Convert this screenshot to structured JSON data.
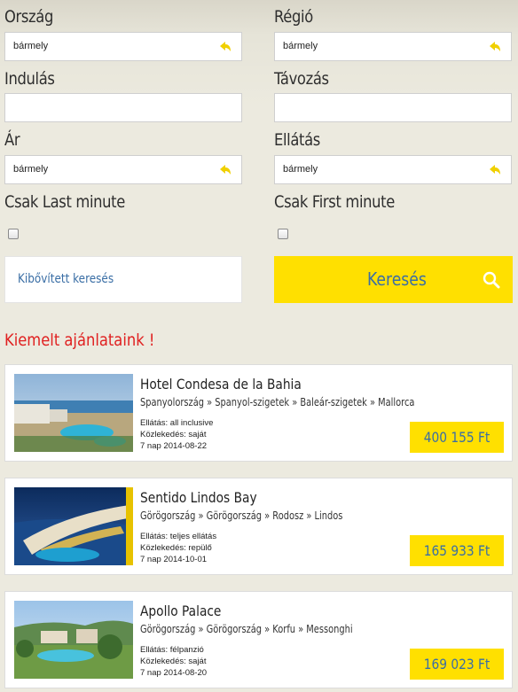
{
  "form": {
    "country": {
      "label": "Ország",
      "value": "bármely"
    },
    "region": {
      "label": "Régió",
      "value": "bármely"
    },
    "departure": {
      "label": "Indulás",
      "value": ""
    },
    "return": {
      "label": "Távozás",
      "value": ""
    },
    "price": {
      "label": "Ár",
      "value": "bármely"
    },
    "board": {
      "label": "Ellátás",
      "value": "bármely"
    },
    "last_minute": {
      "label": "Csak Last minute",
      "checked": false
    },
    "first_minute": {
      "label": "Csak First minute",
      "checked": false
    },
    "advanced_label": "Kibővített keresés",
    "search_label": "Keresés"
  },
  "colors": {
    "accent_yellow": "#ffe000",
    "link_blue": "#3a6ea5",
    "title_red": "#e02020"
  },
  "featured": {
    "title": "Kiemelt ajánlataink !",
    "offers": [
      {
        "name": "Hotel Condesa de la Bahia",
        "path": "Spanyolország » Spanyol-szigetek » Baleár-szigetek » Mallorca",
        "board": "Ellátás: all inclusive",
        "transport": "Közlekedés: saját",
        "duration": "7 nap 2014-08-22",
        "price": "400 155 Ft"
      },
      {
        "name": "Sentido Lindos Bay",
        "path": "Görögország » Görögország » Rodosz » Lindos",
        "board": "Ellátás: teljes ellátás",
        "transport": "Közlekedés: repülő",
        "duration": "7 nap 2014-10-01",
        "price": "165 933 Ft"
      },
      {
        "name": "Apollo Palace",
        "path": "Görögország » Görögország » Korfu » Messonghi",
        "board": "Ellátás: félpanzió",
        "transport": "Közlekedés: saját",
        "duration": "7 nap 2014-08-20",
        "price": "169 023 Ft"
      }
    ]
  }
}
